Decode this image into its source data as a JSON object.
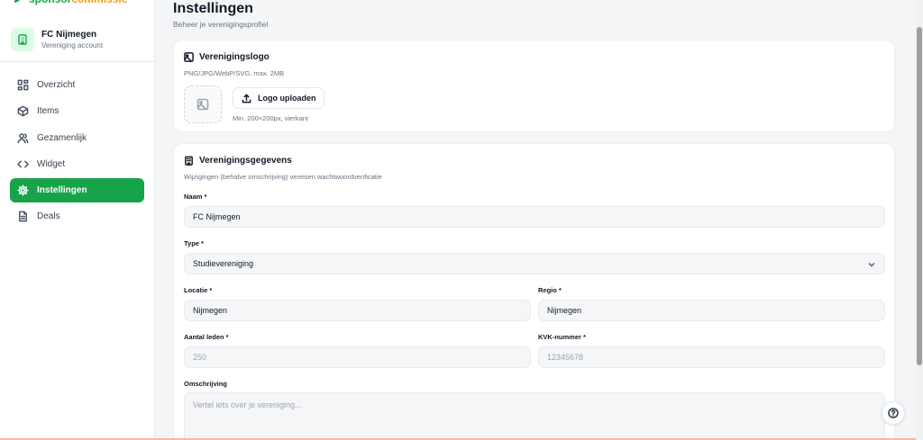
{
  "brand": {
    "part1": "sponsor",
    "part2": "commissie"
  },
  "account": {
    "name": "FC Nijmegen",
    "type": "Vereniging account"
  },
  "nav": [
    {
      "label": "Overzicht",
      "icon": "grid-icon"
    },
    {
      "label": "Items",
      "icon": "box-icon"
    },
    {
      "label": "Gezamenlijk",
      "icon": "users-icon"
    },
    {
      "label": "Widget",
      "icon": "code-icon"
    },
    {
      "label": "Instellingen",
      "icon": "gear-icon",
      "active": true
    },
    {
      "label": "Deals",
      "icon": "document-icon"
    }
  ],
  "page": {
    "title": "Instellingen",
    "subtitle": "Beheer je verenigingsprofiel"
  },
  "logo_card": {
    "title": "Verenigingslogo",
    "formats": "PNG/JPG/WebP/SVG, max. 2MB",
    "upload_label": "Logo uploaden",
    "hint": "Min. 200×200px, vierkant"
  },
  "details_card": {
    "title": "Verenigingsgegevens",
    "description": "Wijzigingen (behalve omschrijving) vereisen wachtwoordverificatie",
    "name_label": "Naam *",
    "name_value": "FC Nijmegen",
    "type_label": "Type *",
    "type_value": "Studievereniging",
    "location_label": "Locatie *",
    "location_value": "Nijmegen",
    "region_label": "Regio *",
    "region_value": "Nijmegen",
    "members_label": "Aantal leden *",
    "members_placeholder": "250",
    "kvk_label": "KVK-nummer *",
    "kvk_placeholder": "12345678",
    "description_label": "Omschrijving",
    "description_placeholder": "Vertel iets over je vereniging..."
  },
  "colors": {
    "accent": "#16a34a",
    "brand_orange": "#f59e0b"
  }
}
